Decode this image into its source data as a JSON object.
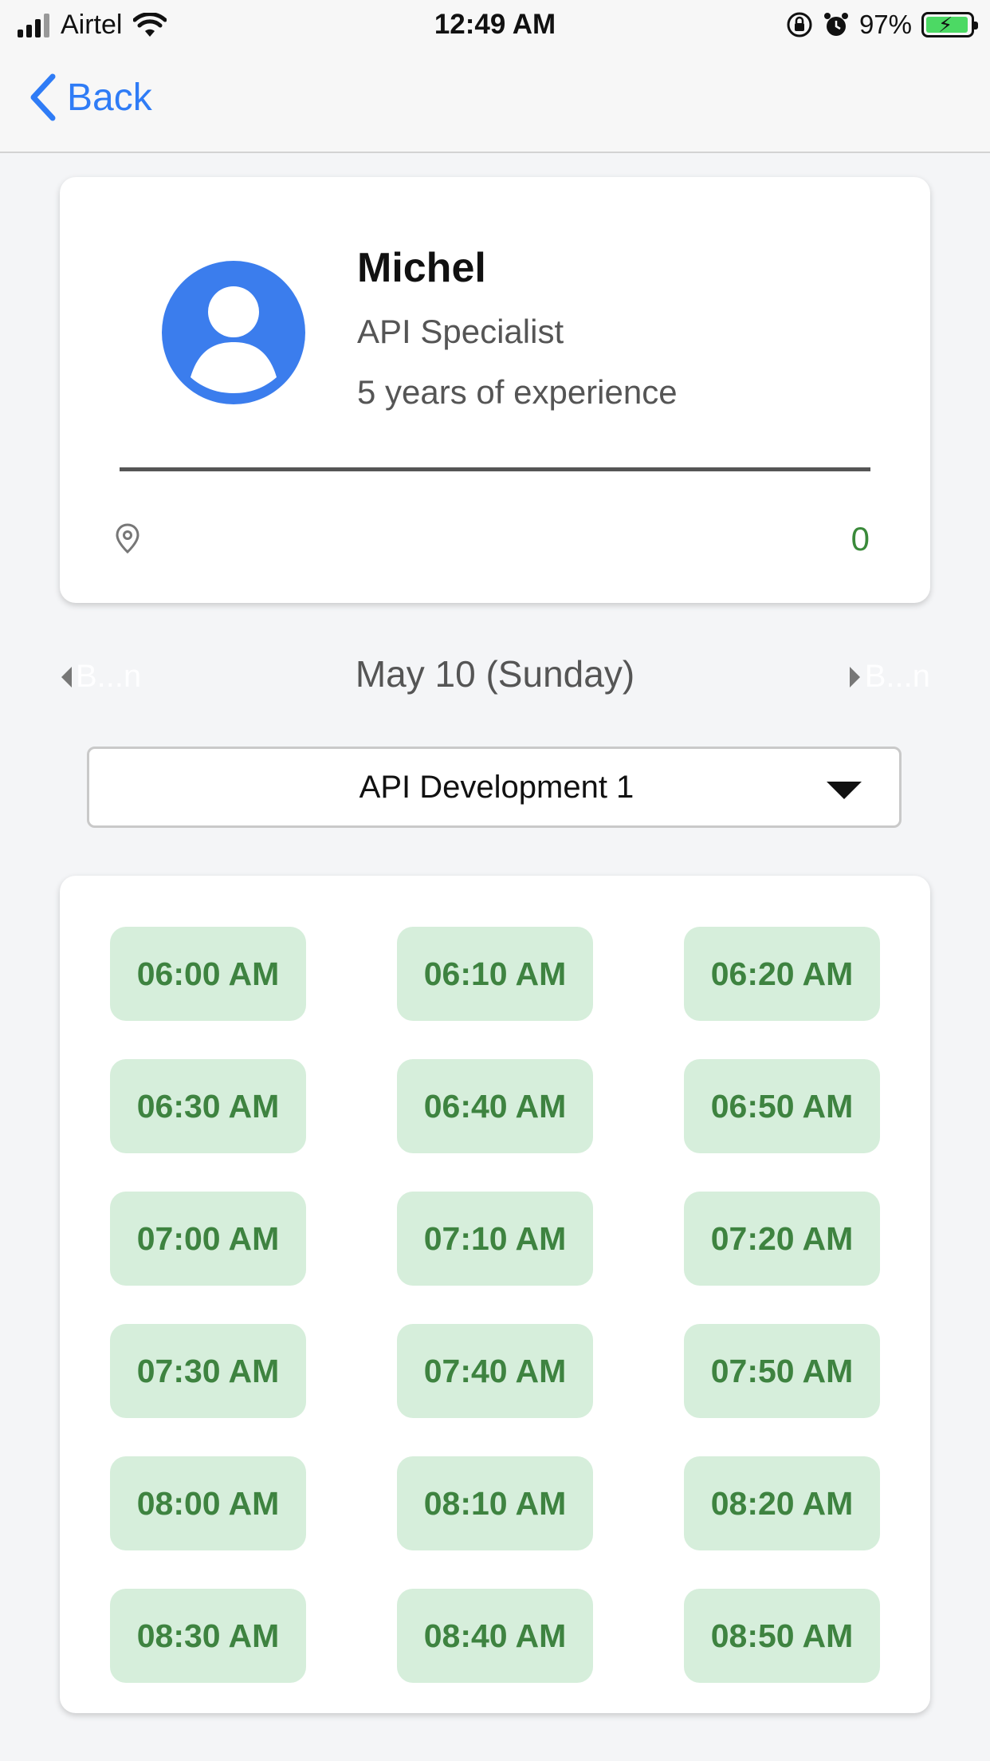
{
  "status_bar": {
    "carrier": "Airtel",
    "time": "12:49 AM",
    "battery": "97%",
    "battery_level": 0.97
  },
  "nav": {
    "back_label": "Back"
  },
  "profile": {
    "name": "Michel",
    "role": "API Specialist",
    "experience": "5 years of experience",
    "count": "0"
  },
  "date_nav": {
    "current": "May 10 (Sunday)",
    "prev_label": "B...n",
    "next_label": "B...n"
  },
  "service_select": {
    "value": "API Development 1"
  },
  "slots": [
    [
      "06:00 AM",
      "06:10 AM",
      "06:20 AM"
    ],
    [
      "06:30 AM",
      "06:40 AM",
      "06:50 AM"
    ],
    [
      "07:00 AM",
      "07:10 AM",
      "07:20 AM"
    ],
    [
      "07:30 AM",
      "07:40 AM",
      "07:50 AM"
    ],
    [
      "08:00 AM",
      "08:10 AM",
      "08:20 AM"
    ],
    [
      "08:30 AM",
      "08:40 AM",
      "08:50 AM"
    ]
  ],
  "colors": {
    "accent": "#2f7cf6",
    "slot_bg": "#d6eedb",
    "slot_text": "#3e8340",
    "count": "#3a8a3a"
  }
}
